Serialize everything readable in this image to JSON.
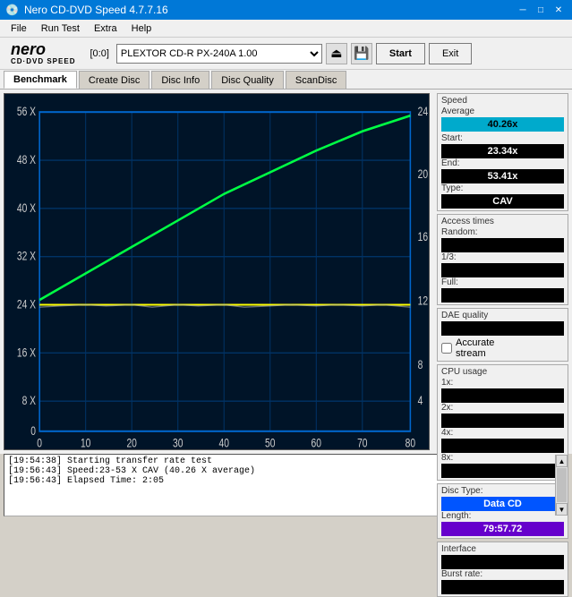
{
  "window": {
    "title": "Nero CD-DVD Speed 4.7.7.16"
  },
  "menu": {
    "items": [
      "File",
      "Run Test",
      "Extra",
      "Help"
    ]
  },
  "toolbar": {
    "drive_label": "[0:0]",
    "drive_value": "PLEXTOR CD-R  PX-240A 1.00",
    "start_label": "Start",
    "exit_label": "Exit"
  },
  "tabs": {
    "items": [
      "Benchmark",
      "Create Disc",
      "Disc Info",
      "Disc Quality",
      "ScanDisc"
    ],
    "active": "Benchmark"
  },
  "speed_info": {
    "average_label": "Average",
    "average_value": "40.26x",
    "start_label": "Start:",
    "start_value": "23.34x",
    "end_label": "End:",
    "end_value": "53.41x",
    "type_label": "Type:",
    "type_value": "CAV"
  },
  "access_times": {
    "label": "Access times",
    "random_label": "Random:",
    "random_value": "",
    "one_third_label": "1/3:",
    "one_third_value": "",
    "full_label": "Full:",
    "full_value": ""
  },
  "dae": {
    "label": "DAE quality",
    "value": "",
    "accurate_label": "Accurate",
    "stream_label": "stream"
  },
  "cpu": {
    "label": "CPU usage",
    "x1_label": "1x:",
    "x1_value": "",
    "x2_label": "2x:",
    "x2_value": "",
    "x4_label": "4x:",
    "x4_value": "",
    "x8_label": "8x:",
    "x8_value": ""
  },
  "disc": {
    "type_label": "Disc",
    "type_sub": "Type:",
    "type_value": "Data CD",
    "length_label": "Length:",
    "length_value": "79:57.72"
  },
  "interface": {
    "label": "Interface",
    "burst_label": "Burst rate:",
    "burst_value": ""
  },
  "chart": {
    "y_left_labels": [
      "56 X",
      "48 X",
      "40 X",
      "32 X",
      "24 X",
      "16 X",
      "8 X",
      "0"
    ],
    "y_right_labels": [
      "24",
      "20",
      "16",
      "12",
      "8",
      "4"
    ],
    "x_labels": [
      "0",
      "10",
      "20",
      "30",
      "40",
      "50",
      "60",
      "70",
      "80"
    ]
  },
  "log": {
    "lines": [
      "[19:54:38]  Starting transfer rate test",
      "[19:56:43]  Speed:23-53 X CAV (40.26 X average)",
      "[19:56:43]  Elapsed Time: 2:05"
    ]
  },
  "icons": {
    "app": "💿",
    "eject": "⏏",
    "save": "💾",
    "minimize": "─",
    "maximize": "□",
    "close": "✕",
    "scroll_up": "▲",
    "scroll_down": "▼"
  }
}
